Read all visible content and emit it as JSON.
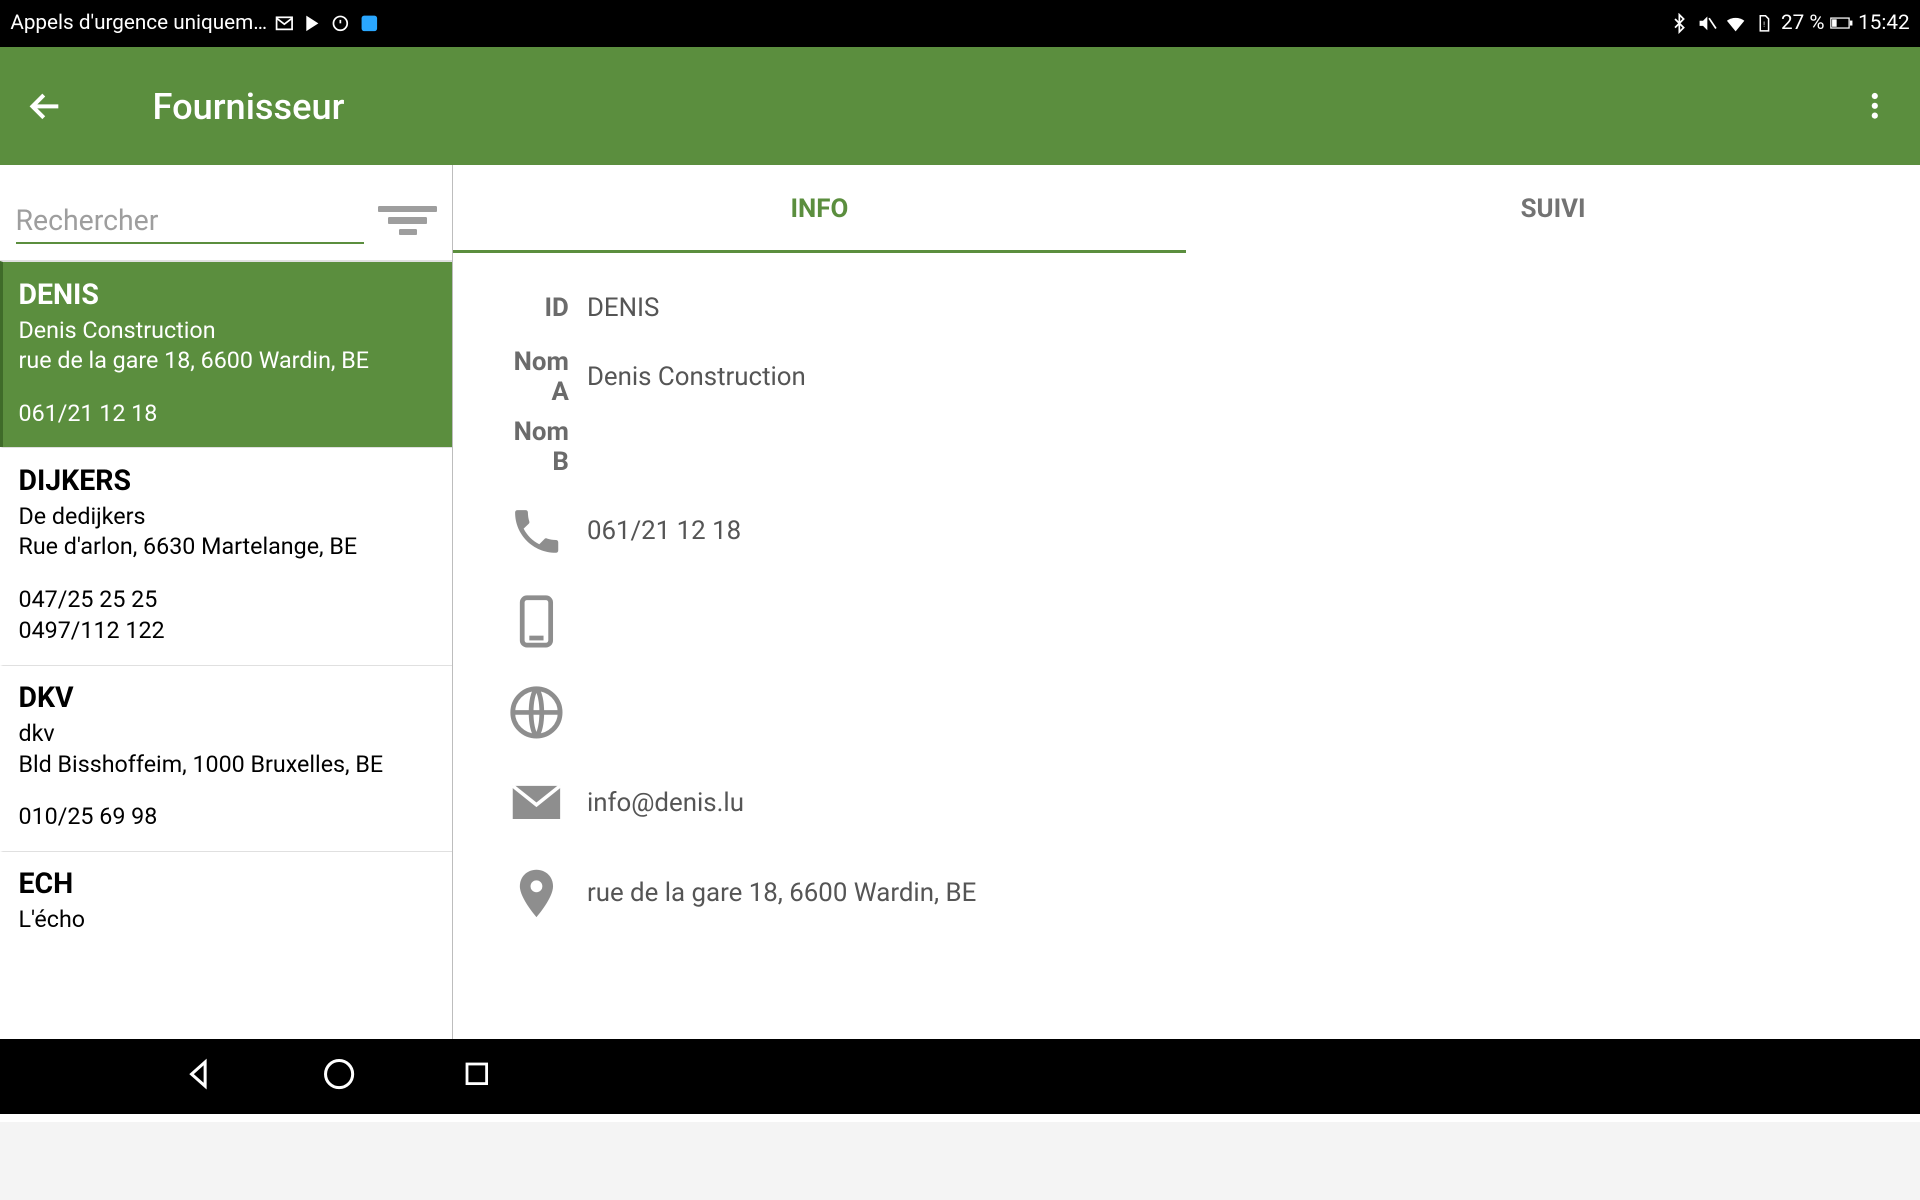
{
  "statusbar": {
    "left_text": "Appels d'urgence uniquem…",
    "battery_pct": "27 %",
    "time": "15:42"
  },
  "appbar": {
    "title": "Fournisseur"
  },
  "search": {
    "placeholder": "Rechercher"
  },
  "list": [
    {
      "id": "DENIS",
      "name": "Denis Construction",
      "address": "rue de la gare 18, 6600 Wardin, BE",
      "phones": [
        "061/21 12 18"
      ],
      "selected": true
    },
    {
      "id": "DIJKERS",
      "name": "De dedijkers",
      "address": "Rue d'arlon, 6630 Martelange, BE",
      "phones": [
        "047/25 25 25",
        "0497/112 122"
      ]
    },
    {
      "id": "DKV",
      "name": "dkv",
      "address": "Bld Bisshoffeim, 1000 Bruxelles, BE",
      "phones": [
        "010/25 69 98"
      ]
    },
    {
      "id": "ECH",
      "name": "L'écho",
      "address": "",
      "phones": []
    }
  ],
  "tabs": {
    "info": "INFO",
    "suivi": "SUIVI"
  },
  "detail": {
    "labels": {
      "id": "ID",
      "nomA": "Nom A",
      "nomB": "Nom B"
    },
    "id": "DENIS",
    "nomA": "Denis Construction",
    "nomB": "",
    "phone": "061/21 12 18",
    "mobile": "",
    "web": "",
    "email": "info@denis.lu",
    "address": "rue de la gare 18, 6600 Wardin, BE"
  }
}
